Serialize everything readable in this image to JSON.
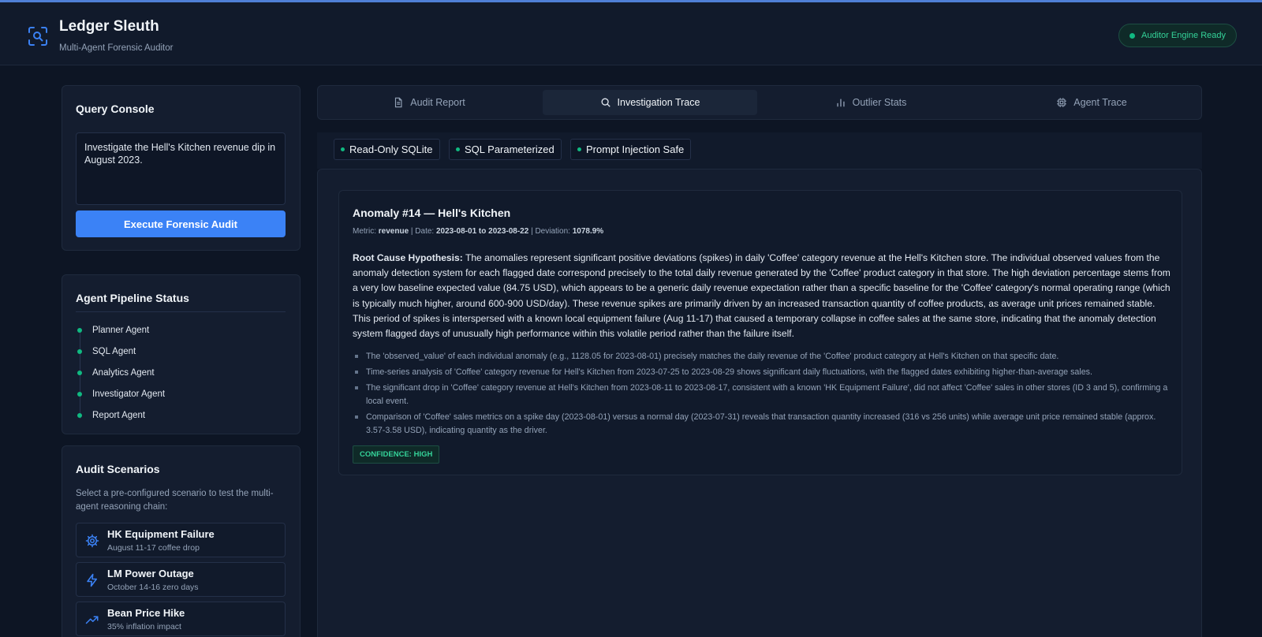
{
  "app": {
    "title": "Ledger Sleuth",
    "subtitle": "Multi-Agent Forensic Auditor",
    "status": "Auditor Engine Ready",
    "accent_color": "#3b82f6",
    "success_color": "#10b981"
  },
  "query_console": {
    "title": "Query Console",
    "query_value": "Investigate the Hell's Kitchen revenue dip in August 2023.",
    "execute_label": "Execute Forensic Audit"
  },
  "pipeline": {
    "title": "Agent Pipeline Status",
    "agents": [
      "Planner Agent",
      "SQL Agent",
      "Analytics Agent",
      "Investigator Agent",
      "Report Agent"
    ]
  },
  "scenarios": {
    "title": "Audit Scenarios",
    "description": "Select a pre-configured scenario to test the multi-agent reasoning chain:",
    "items": [
      {
        "title": "HK Equipment Failure",
        "subtitle": "August 11-17 coffee drop",
        "icon": "gear-icon"
      },
      {
        "title": "LM Power Outage",
        "subtitle": "October 14-16 zero days",
        "icon": "lightning-icon"
      },
      {
        "title": "Bean Price Hike",
        "subtitle": "35% inflation impact",
        "icon": "trending-up-icon"
      }
    ]
  },
  "tabs": [
    {
      "label": "Audit Report",
      "icon": "document-icon"
    },
    {
      "label": "Investigation Trace",
      "icon": "search-icon",
      "active": true
    },
    {
      "label": "Outlier Stats",
      "icon": "bar-chart-icon"
    },
    {
      "label": "Agent Trace",
      "icon": "chip-icon"
    }
  ],
  "badges": [
    "Read-Only SQLite",
    "SQL Parameterized",
    "Prompt Injection Safe"
  ],
  "anomaly": {
    "title": "Anomaly #14 — Hell's Kitchen",
    "meta": {
      "metric_label": "Metric:",
      "metric": "revenue",
      "date_label": "| Date:",
      "date": "2023-08-01 to 2023-08-22",
      "deviation_label": "| Deviation:",
      "deviation": "1078.9%"
    },
    "hypothesis_label": "Root Cause Hypothesis:",
    "hypothesis": "The anomalies represent significant positive deviations (spikes) in daily 'Coffee' category revenue at the Hell's Kitchen store. The individual observed values from the anomaly detection system for each flagged date correspond precisely to the total daily revenue generated by the 'Coffee' product category in that store. The high deviation percentage stems from a very low baseline expected value (84.75 USD), which appears to be a generic daily revenue expectation rather than a specific baseline for the 'Coffee' category's normal operating range (which is typically much higher, around 600-900 USD/day). These revenue spikes are primarily driven by an increased transaction quantity of coffee products, as average unit prices remained stable. This period of spikes is interspersed with a known local equipment failure (Aug 11-17) that caused a temporary collapse in coffee sales at the same store, indicating that the anomaly detection system flagged days of unusually high performance within this volatile period rather than the failure itself.",
    "evidence": [
      "The 'observed_value' of each individual anomaly (e.g., 1128.05 for 2023-08-01) precisely matches the daily revenue of the 'Coffee' product category at Hell's Kitchen on that specific date.",
      "Time-series analysis of 'Coffee' category revenue for Hell's Kitchen from 2023-07-25 to 2023-08-29 shows significant daily fluctuations, with the flagged dates exhibiting higher-than-average sales.",
      "The significant drop in 'Coffee' category revenue at Hell's Kitchen from 2023-08-11 to 2023-08-17, consistent with a known 'HK Equipment Failure', did not affect 'Coffee' sales in other stores (ID 3 and 5), confirming a local event.",
      "Comparison of 'Coffee' sales metrics on a spike day (2023-08-01) versus a normal day (2023-07-31) reveals that transaction quantity increased (316 vs 256 units) while average unit price remained stable (approx. 3.57-3.58 USD), indicating quantity as the driver."
    ],
    "confidence": "CONFIDENCE: HIGH"
  }
}
